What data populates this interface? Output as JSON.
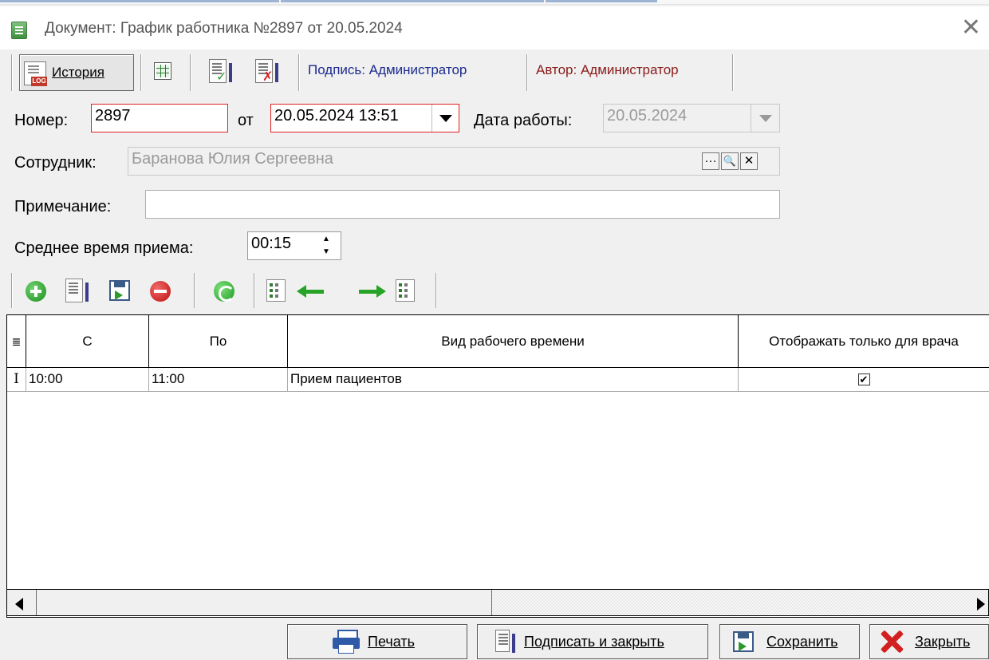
{
  "window": {
    "title": "Документ: График работника №2897 от 20.05.2024",
    "close_glyph": "✕"
  },
  "toolbar": {
    "history_label": "История",
    "history_icon_badge": "LOG",
    "signature_label": "Подпись: Администратор",
    "author_label": "Автор: Администратор",
    "sign_badge": "✓",
    "unsign_badge": "✗",
    "colors": {
      "signature": "#1b2a8f",
      "author": "#8b1a1a"
    }
  },
  "form": {
    "number_label": "Номер:",
    "number_value": "2897",
    "from_label": "от",
    "date_value": "20.05.2024 13:51",
    "work_date_label": "Дата работы:",
    "work_date_value": "20.05.2024",
    "employee_label": "Сотрудник:",
    "employee_value": "Баранова Юлия Сергеевна",
    "employee_btn_dots": "···",
    "employee_btn_search": "🔍",
    "employee_btn_clear": "✕",
    "note_label": "Примечание:",
    "note_value": "",
    "avg_time_label": "Среднее время приема:",
    "avg_time_value": "00:15",
    "spin_up": "▲",
    "spin_down": "▼"
  },
  "grid": {
    "columns": [
      "C",
      "По",
      "Вид рабочего времени",
      "Отображать только для врача"
    ],
    "header_icon": "≣",
    "rows": [
      {
        "marker": "I",
        "from": "10:00",
        "to": "11:00",
        "type": "Прием пациентов",
        "doctor_only": "✔"
      }
    ]
  },
  "buttons": {
    "print": "Печать",
    "sign_close": "Подписать и закрыть",
    "save": "Сохранить",
    "close": "Закрыть"
  }
}
